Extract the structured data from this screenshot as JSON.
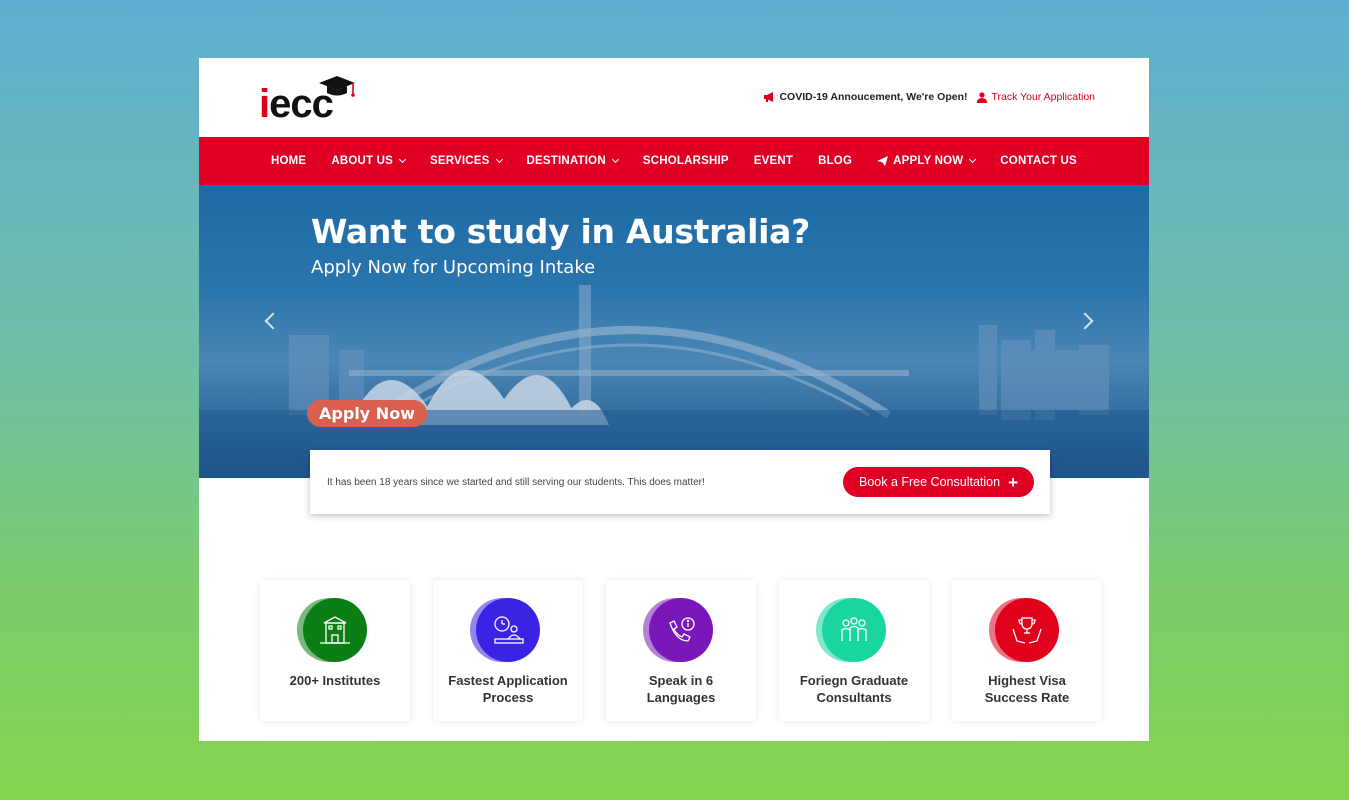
{
  "brand": {
    "logo_text": "iecc",
    "colors": {
      "primary": "#df0024",
      "dark": "#111111"
    }
  },
  "top_links": {
    "covid": {
      "icon": "megaphone-icon",
      "label": "COVID-19 Annoucement, We're Open!"
    },
    "track": {
      "icon": "user-icon",
      "label": "Track Your Application"
    }
  },
  "nav": {
    "items": [
      {
        "label": "HOME",
        "dropdown": false
      },
      {
        "label": "ABOUT US",
        "dropdown": true
      },
      {
        "label": "SERVICES",
        "dropdown": true
      },
      {
        "label": "DESTINATION",
        "dropdown": true
      },
      {
        "label": "SCHOLARSHIP",
        "dropdown": false
      },
      {
        "label": "EVENT",
        "dropdown": false
      },
      {
        "label": "BLOG",
        "dropdown": false
      },
      {
        "label": "APPLY NOW",
        "dropdown": true,
        "icon": "paper-plane-icon"
      },
      {
        "label": "CONTACT US",
        "dropdown": false
      }
    ]
  },
  "hero": {
    "title": "Want to study in Australia?",
    "subtitle": "Apply Now for Upcoming Intake",
    "button": "Apply Now"
  },
  "info": {
    "text": "It has been 18 years since we started and still serving our students. This does matter!",
    "button": "Book a Free Consultation",
    "button_icon": "+"
  },
  "features": [
    {
      "label": "200+ Institutes",
      "icon": "building-icon",
      "color": "#0b7e16"
    },
    {
      "label": "Fastest Application Process",
      "icon": "clock-desk-icon",
      "color": "#3b23e6"
    },
    {
      "label": "Speak in 6 Languages",
      "icon": "phone-info-icon",
      "color": "#7a17b8"
    },
    {
      "label": "Foriegn Graduate Consultants",
      "icon": "team-icon",
      "color": "#19d6a0"
    },
    {
      "label": "Highest Visa Success Rate",
      "icon": "trophy-hands-icon",
      "color": "#e0001b"
    }
  ]
}
